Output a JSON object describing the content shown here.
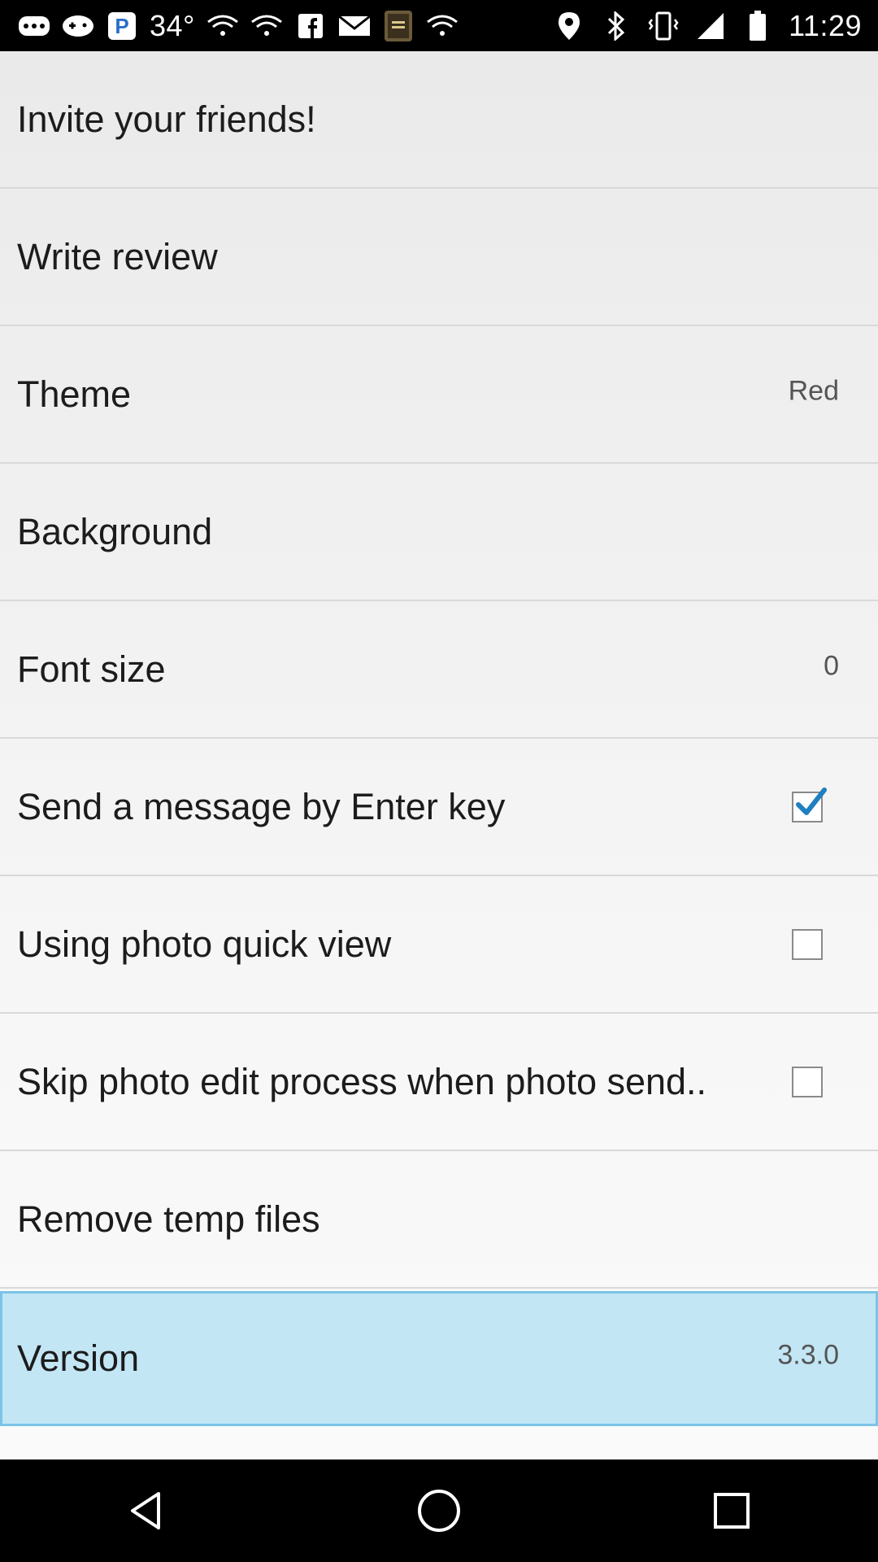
{
  "status_bar": {
    "left_icons": [
      "messages-icon",
      "gamepad-icon",
      "pandora-icon"
    ],
    "temperature": "34°",
    "more_icons": [
      "wifi-icon",
      "wifi-icon",
      "facebook-icon",
      "gmail-icon",
      "holy-bible-icon",
      "wifi-icon"
    ],
    "right_icons": [
      "location-icon",
      "bluetooth-icon",
      "vibrate-icon",
      "signal-icon",
      "battery-icon"
    ],
    "time": "11:29"
  },
  "settings": [
    {
      "label": "Invite your friends!"
    },
    {
      "label": "Write review"
    },
    {
      "label": "Theme",
      "value": "Red"
    },
    {
      "label": "Background"
    },
    {
      "label": "Font size",
      "value": "0"
    },
    {
      "label": "Send a message by Enter key",
      "checked": true
    },
    {
      "label": "Using photo quick view",
      "checked": false
    },
    {
      "label": "Skip photo edit process when photo send..",
      "checked": false
    },
    {
      "label": "Remove temp files"
    },
    {
      "label": "Version",
      "value": "3.3.0",
      "highlighted": true
    }
  ],
  "nav_bar": {
    "buttons": [
      "back-icon",
      "home-icon",
      "recents-icon"
    ]
  },
  "colors": {
    "highlight_bg": "#c3e6f5",
    "highlight_border": "#7cc4e6",
    "checkmark": "#1f7fc0"
  }
}
